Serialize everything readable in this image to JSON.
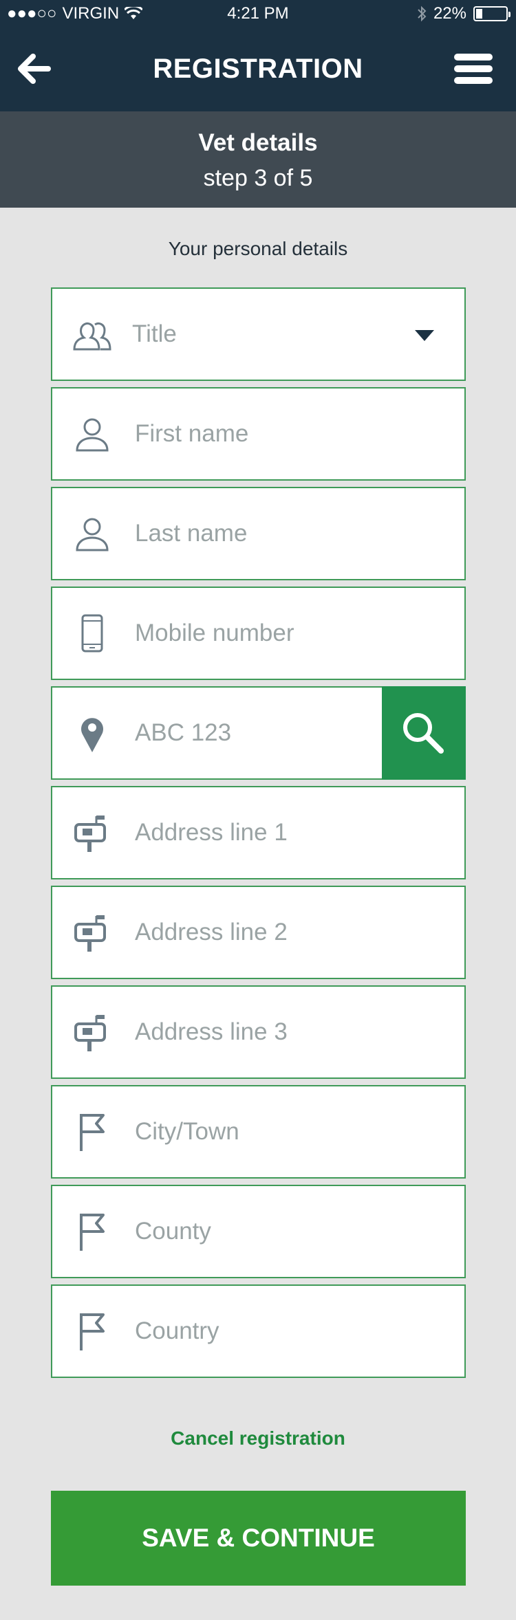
{
  "status_bar": {
    "signal": "●●●○○",
    "carrier": "VIRGIN",
    "time": "4:21 PM",
    "battery": "22%",
    "battery_level": 0.22
  },
  "nav": {
    "title": "REGISTRATION",
    "back_icon": "arrow-left-icon",
    "menu_icon": "hamburger-menu-icon"
  },
  "step": {
    "title": "Vet details",
    "subtitle": "step 3 of 5"
  },
  "form": {
    "section_label": "Your personal details",
    "fields": [
      {
        "icon": "people-icon",
        "placeholder": "Title",
        "type": "select"
      },
      {
        "icon": "user-icon",
        "placeholder": "First name"
      },
      {
        "icon": "user-icon",
        "placeholder": "Last name"
      },
      {
        "icon": "mobile-phone-icon",
        "placeholder": "Mobile number"
      },
      {
        "icon": "map-pin-icon",
        "placeholder": "ABC 123"
      },
      {
        "icon": "mailbox-icon",
        "placeholder": "Address line 1"
      },
      {
        "icon": "mailbox-icon",
        "placeholder": "Address line 2"
      },
      {
        "icon": "mailbox-icon",
        "placeholder": "Address line 3"
      },
      {
        "icon": "flag-icon",
        "placeholder": "City/Town"
      },
      {
        "icon": "flag-icon",
        "placeholder": "County"
      },
      {
        "icon": "flag-icon",
        "placeholder": "Country"
      }
    ]
  },
  "actions": {
    "cancel_label": "Cancel registration",
    "save_label": "SAVE & CONTINUE"
  },
  "colors": {
    "header_bg": "#1b3142",
    "step_bg": "#404a52",
    "field_border": "#3f9a58",
    "search_button": "#21924f",
    "save_button": "#359b36",
    "cancel_text": "#1f8a3d"
  }
}
